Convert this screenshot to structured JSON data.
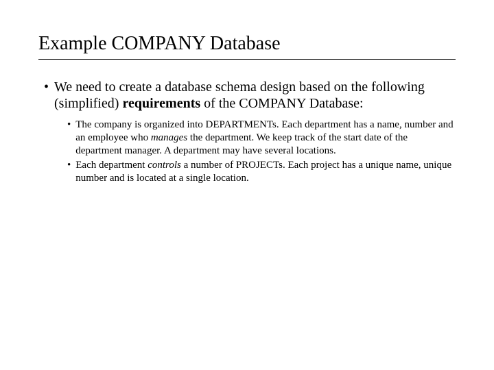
{
  "title": "Example COMPANY Database",
  "main_bullet": {
    "pre": "We need to create a database schema design based on the following (simplified) ",
    "bold": "requirements",
    "post": " of the COMPANY Database:"
  },
  "sub_bullets": [
    {
      "p1": "The company is organized into DEPARTMENTs. Each department has a name, number and an employee who ",
      "em1": "manages",
      "p2": " the department. We keep track of the start date of the department manager. A department may have several locations."
    },
    {
      "p1": "Each department ",
      "em1": "controls",
      "p2": " a number of PROJECTs. Each project has a unique name, unique number and is located at a single location."
    }
  ]
}
